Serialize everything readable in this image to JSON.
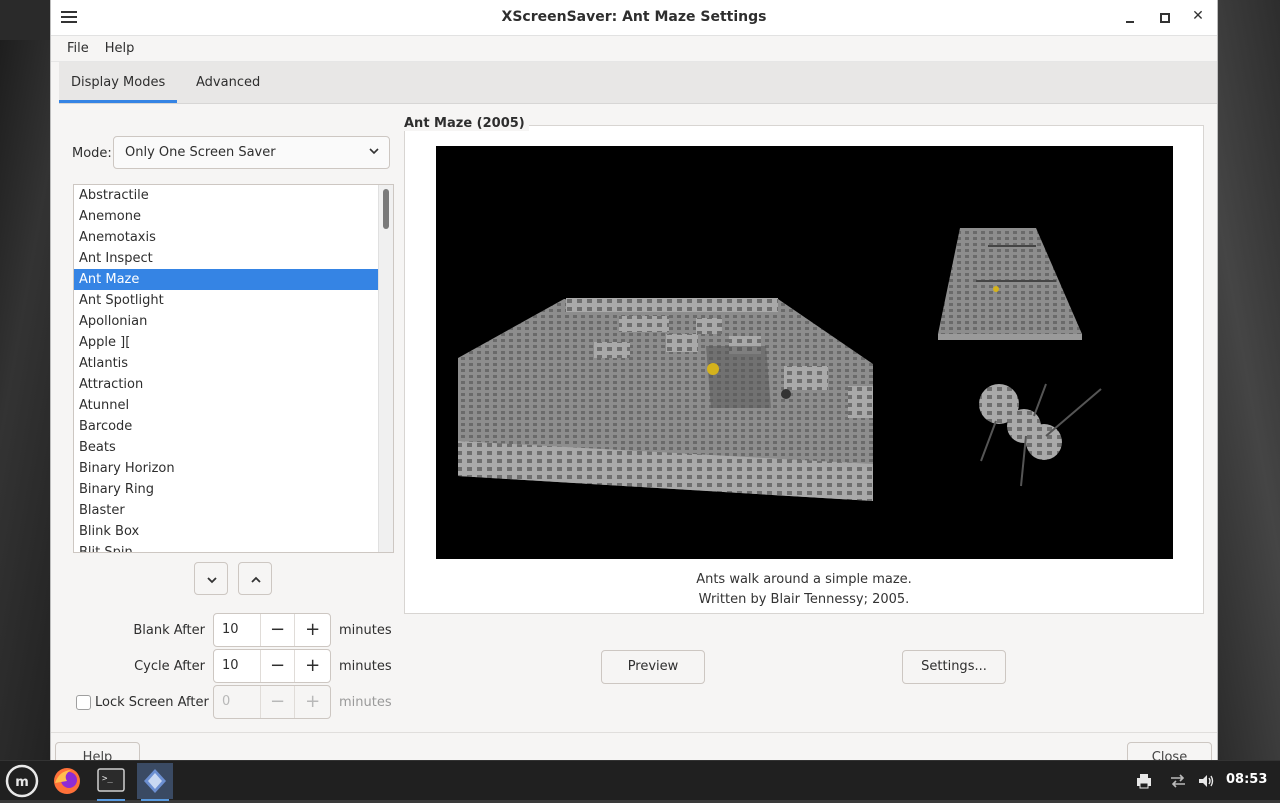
{
  "window": {
    "title": "XScreenSaver: Ant Maze Settings"
  },
  "menubar": [
    "File",
    "Help"
  ],
  "tabs": [
    "Display Modes",
    "Advanced"
  ],
  "mode": {
    "label": "Mode:",
    "value": "Only One Screen Saver"
  },
  "savers": [
    "Abstractile",
    "Anemone",
    "Anemotaxis",
    "Ant Inspect",
    "Ant Maze",
    "Ant Spotlight",
    "Apollonian",
    "Apple ][",
    "Atlantis",
    "Attraction",
    "Atunnel",
    "Barcode",
    "Beats",
    "Binary Horizon",
    "Binary Ring",
    "Blaster",
    "Blink Box",
    "Blit Spin"
  ],
  "selected_index": 4,
  "blank_after": {
    "label": "Blank After",
    "value": "10",
    "unit": "minutes"
  },
  "cycle_after": {
    "label": "Cycle After",
    "value": "10",
    "unit": "minutes"
  },
  "lock_after": {
    "label": "Lock Screen After",
    "value": "0",
    "unit": "minutes",
    "checked": false
  },
  "spin_minus": "−",
  "spin_plus": "+",
  "saver_info": {
    "title": "Ant Maze (2005)",
    "description": "Ants walk around a simple maze.",
    "credit": "Written by Blair Tennessy; 2005."
  },
  "buttons": {
    "preview": "Preview",
    "settings": "Settings...",
    "help": "Help",
    "close": "Close"
  },
  "taskbar": {
    "clock": "08:53",
    "apps": [
      "mint-menu-icon",
      "firefox-icon",
      "terminal-icon",
      "xscreensaver-icon"
    ]
  },
  "colors": {
    "accent": "#3584e4",
    "taskbar": "#202020"
  }
}
